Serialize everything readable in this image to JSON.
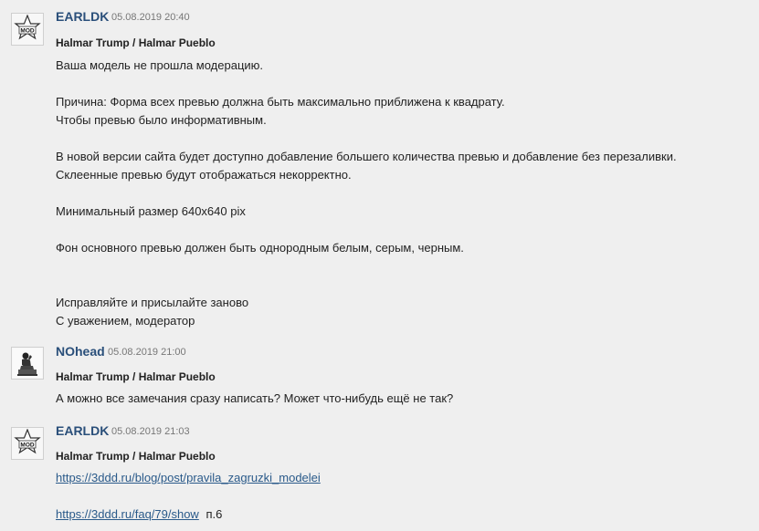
{
  "messages": [
    {
      "author": "EARLDK",
      "date": "05.08.2019 20:40",
      "avatar_icon": "moderator-star-badge-icon",
      "avatar_text": "MOD",
      "subject": "Halmar Trump / Halmar Pueblo",
      "lines": [
        "Ваша модель не прошла модерацию.",
        "",
        "Причина: Форма всех превью должна быть максимально приближена к квадрату.",
        "Чтобы превью было информативным.",
        "",
        "В новой версии сайта будет доступно добавление большего количества превью и добавление без перезаливки.",
        "Склеенные превью будут отображаться некорректно.",
        "",
        "Минимальный размер 640x640 pix",
        "",
        "Фон основного превью должен быть однородным белым, серым, черным.",
        "",
        "",
        "Исправляйте и присылайте заново",
        "С уважением, модератор"
      ]
    },
    {
      "author": "NOhead",
      "date": "05.08.2019 21:00",
      "avatar_icon": "thinker-statue-icon",
      "subject": "Halmar Trump / Halmar Pueblo",
      "lines": [
        "А можно все замечания сразу написать? Может что-нибудь ещё не так?"
      ]
    },
    {
      "author": "EARLDK",
      "date": "05.08.2019 21:03",
      "avatar_icon": "moderator-star-badge-icon",
      "avatar_text": "MOD",
      "subject": "Halmar Trump / Halmar Pueblo",
      "link1": "https://3ddd.ru/blog/post/pravila_zagruzki_modelei",
      "link2": "https://3ddd.ru/faq/79/show",
      "link2_suffix": "п.6"
    }
  ]
}
